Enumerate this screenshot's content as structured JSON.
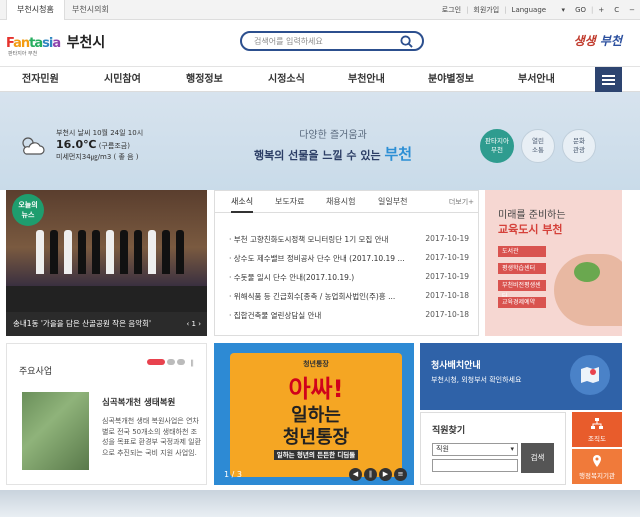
{
  "topbar": {
    "tabs": [
      "부천시청홈",
      "부천시의회"
    ],
    "links": [
      "로그인",
      "회원가입",
      "Language",
      "GO",
      "+",
      "C",
      "−"
    ]
  },
  "header": {
    "logo_brand": "Fantasia",
    "logo_city": "부천시",
    "logo_sub": "판타지아 부천",
    "search_placeholder": "검색어를 입력하세요",
    "slogan_1": "생생",
    "slogan_2": "부천"
  },
  "gnb": {
    "items": [
      "전자민원",
      "시민참여",
      "행정정보",
      "시정소식",
      "부천안내",
      "분야별정보",
      "부서안내"
    ]
  },
  "hero": {
    "weather_line": "부천시 날씨 10월 24일 10시",
    "temp": "16.0℃",
    "condition": "(구름조금)",
    "dust": "미세먼지34㎍/m3 ( 좋 음 )",
    "copy_1": "다양한 즐거움과",
    "copy_2": "행복의 선물을 느낄 수 있는",
    "copy_brand": "부천",
    "circles": [
      {
        "l1": "판타지아",
        "l2": "부천"
      },
      {
        "l1": "열린",
        "l2": "소통"
      },
      {
        "l1": "문화",
        "l2": "관광"
      }
    ]
  },
  "photo_news": {
    "badge_1": "오늘의",
    "badge_2": "뉴스",
    "caption": "송내1동 '가을을 담은 산골공원 작은 음악회'",
    "nav": "‹ 1 ›"
  },
  "news": {
    "tabs": [
      "새소식",
      "보도자료",
      "채용시험",
      "일일부천"
    ],
    "more": "더보기+",
    "rows": [
      {
        "title": "· 부천 고향친화도시정책 모니터링단 1기 모집 안내",
        "date": "2017-10-19"
      },
      {
        "title": "· 상수도 제수밸브 정비공사 단수 안내 (2017.10.19 ...",
        "date": "2017-10-19"
      },
      {
        "title": "· 수돗물 일시 단수 안내(2017.10.19.)",
        "date": "2017-10-19"
      },
      {
        "title": "· 위해식품 등 긴급회수[종축 / 농업회사법인(주)흥 ...",
        "date": "2017-10-18"
      },
      {
        "title": "· 집합건축물 열린상담실 안내",
        "date": "2017-10-18"
      }
    ]
  },
  "edu": {
    "line1": "미래를 준비하는",
    "line2": "교육도시 부천",
    "chips": [
      "도서관",
      "평생학습센터",
      "부천비전평생센터",
      "교육경제예약"
    ]
  },
  "major": {
    "title": "주요사업",
    "heading": "심곡복개천 생태복원",
    "body": "심곡복개천 생태 복원사업은 연차별로 전국 50개소의 생태하천 조성을 목표로 환경부 국정과제 일환으로 추진되는 국비 지원 사업임."
  },
  "banner": {
    "top": "청년통장",
    "line1": "아싸!",
    "line2": "일하는",
    "line3": "청년통장",
    "line4": "일하는 청년의 든든한 디딤돌",
    "counter": "1 / 3"
  },
  "office": {
    "title": "청사배치안내",
    "sub": "부천시청, 외청부서 확인하세요"
  },
  "staff": {
    "title": "직원찾기",
    "select_value": "직원",
    "button": "검색"
  },
  "quick": {
    "org": "조직도",
    "loc": "행정복지기관"
  },
  "colors": {
    "brand_blue": "#2c4f8e",
    "nav_dark": "#2d4470",
    "accent_red": "#e8424e",
    "office_blue": "#2f62a8",
    "quick_orange": "#e85c2c"
  }
}
